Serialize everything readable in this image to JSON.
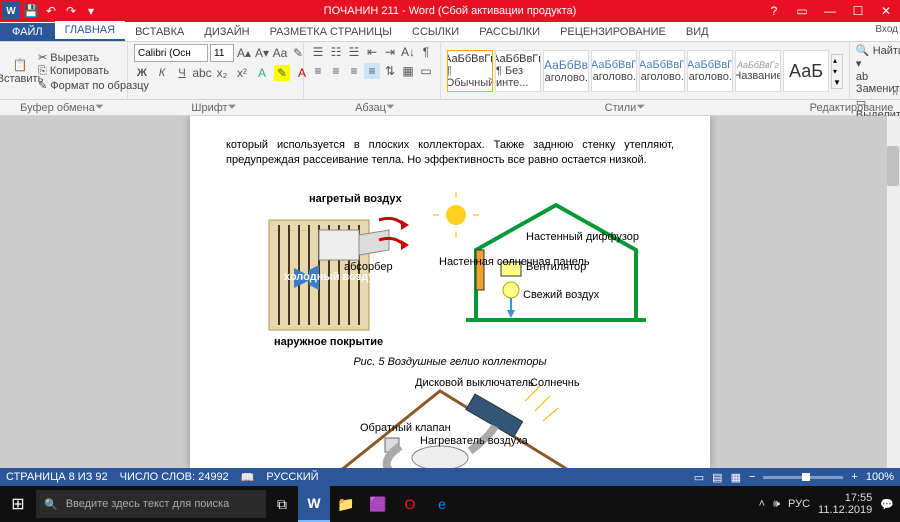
{
  "titlebar": {
    "app_icon": "W",
    "doc_title": "ПОЧАНИН 211 - Word (Сбой активации продукта)",
    "login_hint": "Вход"
  },
  "tabs": {
    "file": "ФАЙЛ",
    "items": [
      "ГЛАВНАЯ",
      "ВСТАВКА",
      "ДИЗАЙН",
      "РАЗМЕТКА СТРАНИЦЫ",
      "ССЫЛКИ",
      "РАССЫЛКИ",
      "РЕЦЕНЗИРОВАНИЕ",
      "ВИД"
    ],
    "active_index": 0
  },
  "ribbon": {
    "clipboard": {
      "paste": "Вставить",
      "cut": "Вырезать",
      "copy": "Копировать",
      "format": "Формат по образцу",
      "label": "Буфер обмена"
    },
    "font": {
      "name": "Calibri (Осн",
      "size": "11",
      "label": "Шрифт"
    },
    "paragraph": {
      "label": "Абзац"
    },
    "styles": {
      "label": "Стили",
      "items": [
        {
          "sample": "АаБбВвГг,",
          "name": "¶ Обычный"
        },
        {
          "sample": "АаБбВвГг,",
          "name": "¶ Без инте..."
        },
        {
          "sample": "АаБбВв",
          "name": "Заголово..."
        },
        {
          "sample": "АаБбВвГ",
          "name": "Заголово..."
        },
        {
          "sample": "АаБбВвГ",
          "name": "Заголово..."
        },
        {
          "sample": "АаБбВвГ",
          "name": "Заголово..."
        },
        {
          "sample": "АаБбВвГг",
          "name": "Название"
        },
        {
          "sample": "АаБ",
          "name": ""
        }
      ]
    },
    "editing": {
      "find": "Найти",
      "replace": "Заменить",
      "select": "Выделить",
      "label": "Редактирование"
    }
  },
  "document": {
    "body_text": "который используется в плоских коллекторах. Также заднюю стенку утепляют, предупреждая рассеивание тепла. Но эффективность все равно остается низкой.",
    "fig1": {
      "hot_air": "нагретый воздух",
      "absorber": "абсорбер",
      "cold_air": "холодный воздух",
      "coating": "наружное покрытие"
    },
    "fig2": {
      "diffuser": "Настенный диффузор",
      "panel": "Настенная солнечная панель",
      "fan": "Вентилятор",
      "fresh": "Свежий воздух"
    },
    "caption": "Рис. 5 Воздушные гелио коллекторы",
    "fig3": {
      "switch": "Дисковой выключатель",
      "sun": "Солнечный свет",
      "valve": "Обратный клапан",
      "heater": "Нагреватель воздуха"
    }
  },
  "statusbar": {
    "page": "СТРАНИЦА 8 ИЗ 92",
    "words": "ЧИСЛО СЛОВ: 24992",
    "lang": "РУССКИЙ",
    "zoom": "100%"
  },
  "taskbar": {
    "search_placeholder": "Введите здесь текст для поиска",
    "lang": "РУС",
    "time": "17:55",
    "date": "11.12.2019"
  }
}
